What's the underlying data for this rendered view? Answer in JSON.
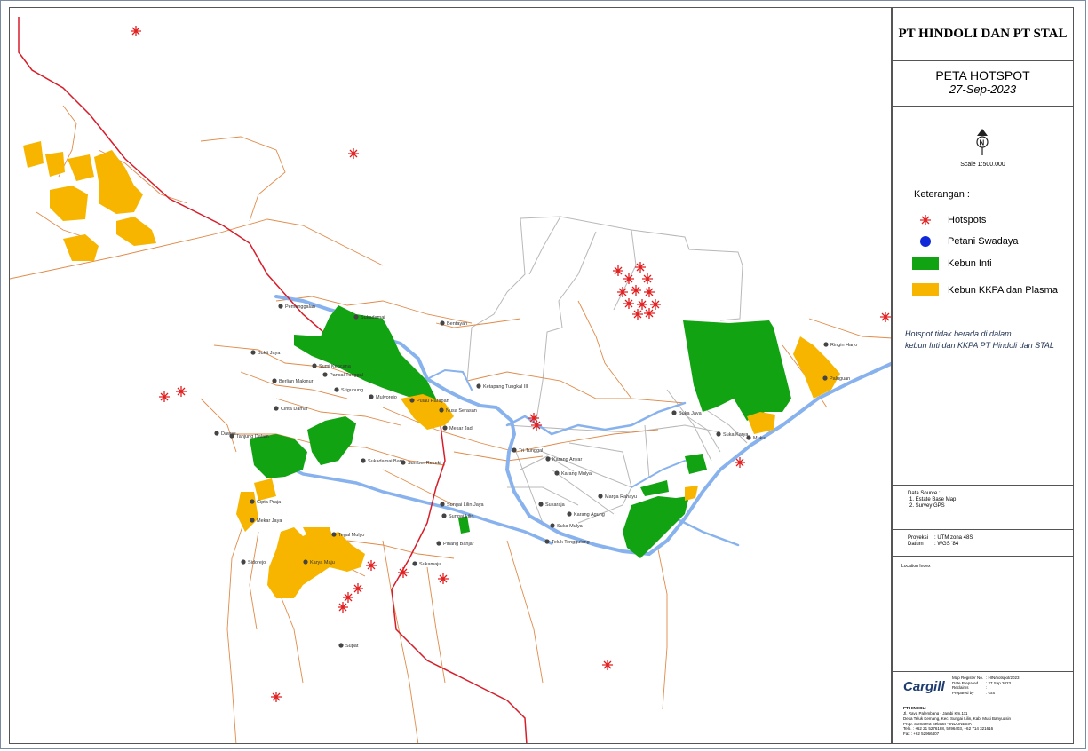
{
  "title": "PT HINDOLI DAN PT STAL",
  "map_title": "PETA HOTSPOT",
  "map_date": "27-Sep-2023",
  "scale_text": "Scale 1:500.000",
  "legend": {
    "heading": "Keterangan :",
    "items": [
      {
        "label": "Hotspots",
        "symbol": "asterisk",
        "color": "#e02020"
      },
      {
        "label": "Petani Swadaya",
        "symbol": "circle",
        "color": "#1028d8"
      },
      {
        "label": "Kebun Inti",
        "symbol": "square",
        "color": "#11a311"
      },
      {
        "label": "Kebun KKPA dan Plasma",
        "symbol": "square",
        "color": "#f7b500"
      }
    ]
  },
  "note_line1": "Hotspot tidak berada di dalam",
  "note_line2": "kebun Inti dan KKPA PT Hindoli dan STAL",
  "data_source": {
    "heading": "Data Source :",
    "items": [
      "1. Estate Base Map",
      "2. Survey GPS"
    ]
  },
  "projection": {
    "label": "Proyeksi",
    "value": "UTM zona 48S"
  },
  "datum": {
    "label": "Datum",
    "value": "WGS '84"
  },
  "location_index": "Location Index",
  "logo": "Cargill",
  "map_info": [
    {
      "label": "Map Register No.",
      "value": "HIN/hotspot/2023"
    },
    {
      "label": "Date Prepared",
      "value": "27 Sep 2023"
    },
    {
      "label": "Reclaims",
      "value": ""
    },
    {
      "label": "Prepared by",
      "value": "GIS"
    }
  ],
  "company": {
    "name": "PT HINDOLI",
    "lines": [
      "Jl. Raya Palembang - Jambi Km.111",
      "Desa Teluk Kemang, Kec. Sungai Lilin, Kab. Musi Banyuasin",
      "Prop. Sumatera Selatan - INDONESIA",
      "Telp. : +62 21 5276188, 5296403, +62 714 321616",
      "Fax : +62 52966407"
    ]
  },
  "places": [
    {
      "name": "Pemenggalan"
    },
    {
      "name": "Sukadamai"
    },
    {
      "name": "Bentayan"
    },
    {
      "name": "Bukit Jaya"
    },
    {
      "name": "Sumi Kencana"
    },
    {
      "name": "Pancal Tunggal"
    },
    {
      "name": "Berlian Makmur"
    },
    {
      "name": "Srigunung"
    },
    {
      "name": "Mulyorejo"
    },
    {
      "name": "Pulau Harapan"
    },
    {
      "name": "Ketapang Tungkal III"
    },
    {
      "name": "Nusa Serasan"
    },
    {
      "name": "Cinta Damai"
    },
    {
      "name": "Mekar Jadi"
    },
    {
      "name": "Dawas"
    },
    {
      "name": "Tanjung Dalam"
    },
    {
      "name": "Sukadamai Baru"
    },
    {
      "name": "Sumber Rezeki"
    },
    {
      "name": "Tri Tunggal"
    },
    {
      "name": "Karang Anyar"
    },
    {
      "name": "Karang Mulya"
    },
    {
      "name": "Marga Rahayu"
    },
    {
      "name": "Sukaraja"
    },
    {
      "name": "Karang Agung"
    },
    {
      "name": "Suka Mulya"
    },
    {
      "name": "Teluk Tenggulang"
    },
    {
      "name": "Cipta Praja"
    },
    {
      "name": "Mekar Jaya"
    },
    {
      "name": "Sungai Lilin Jaya"
    },
    {
      "name": "Sungai Lilin"
    },
    {
      "name": "Pinang Banjar"
    },
    {
      "name": "Tegal Mulyo"
    },
    {
      "name": "Sidorejo"
    },
    {
      "name": "Karya Maju"
    },
    {
      "name": "Sukamaju"
    },
    {
      "name": "Supat"
    },
    {
      "name": "Suka Jaya"
    },
    {
      "name": "Suka Karya"
    },
    {
      "name": "Mukut"
    },
    {
      "name": "Ringin Harjo"
    },
    {
      "name": "Paluguan"
    }
  ]
}
